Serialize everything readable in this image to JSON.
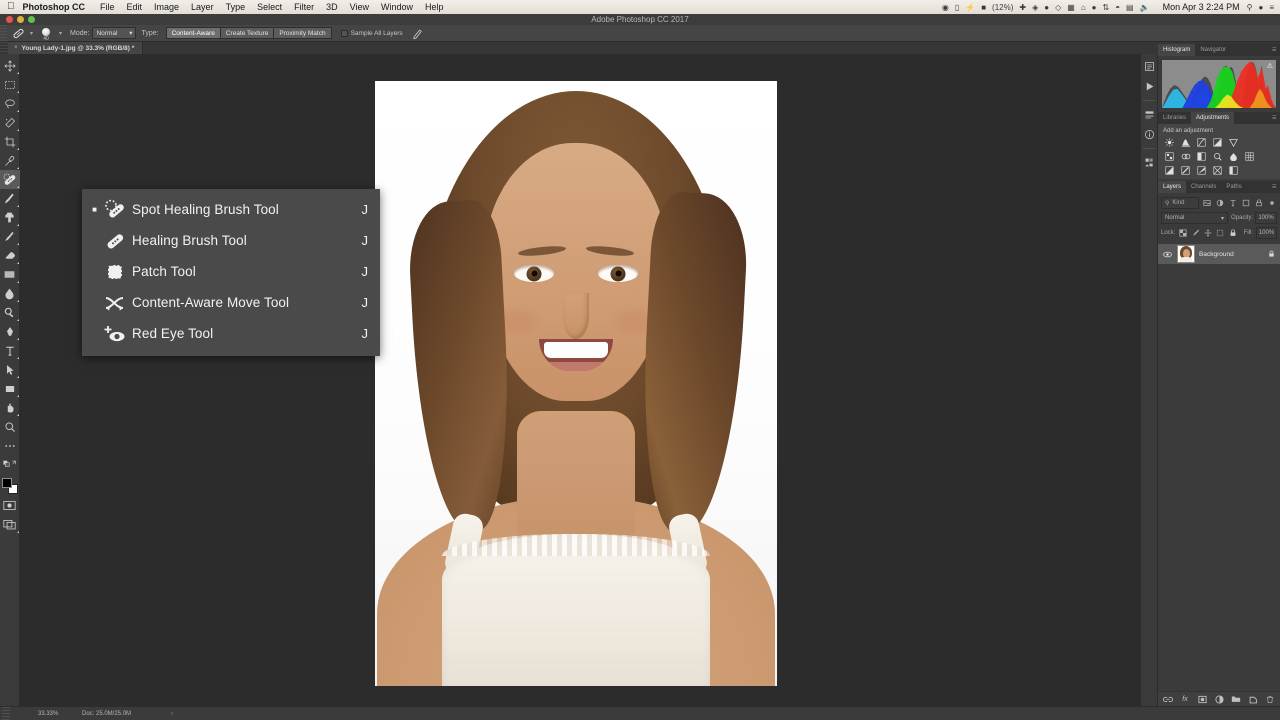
{
  "macmenu": {
    "apple": "apple-logo",
    "app_name": "Photoshop CC",
    "items": [
      "File",
      "Edit",
      "Image",
      "Layer",
      "Type",
      "Select",
      "Filter",
      "3D",
      "View",
      "Window",
      "Help"
    ],
    "battery": "(12%)",
    "clock": "Mon Apr 3  2:24 PM"
  },
  "titlebar": {
    "title": "Adobe Photoshop CC 2017"
  },
  "options": {
    "tool_icon": "spot-healing-brush-icon",
    "brush_size": "40",
    "mode_label": "Mode:",
    "mode_value": "Normal",
    "type_label": "Type:",
    "type_options": [
      "Content-Aware",
      "Create Texture",
      "Proximity Match"
    ],
    "type_selected": "Content-Aware",
    "sample_all_layers": "Sample All Layers",
    "pressure_icon": "pressure-pen-icon"
  },
  "doctab": {
    "close": "×",
    "title": "Young Lady-1.jpg @ 33.3% (RGB/8) *"
  },
  "toolbar": {
    "tools": [
      {
        "name": "move-tool",
        "selected": false
      },
      {
        "name": "rectangular-marquee-tool",
        "selected": false
      },
      {
        "name": "lasso-tool",
        "selected": false
      },
      {
        "name": "quick-selection-tool",
        "selected": false
      },
      {
        "name": "crop-tool",
        "selected": false
      },
      {
        "name": "eyedropper-tool",
        "selected": false
      },
      {
        "name": "spot-healing-brush-tool",
        "selected": true
      },
      {
        "name": "brush-tool",
        "selected": false
      },
      {
        "name": "clone-stamp-tool",
        "selected": false
      },
      {
        "name": "eraser-tool",
        "selected": false
      },
      {
        "name": "gradient-tool",
        "selected": false
      },
      {
        "name": "blur-tool",
        "selected": false
      },
      {
        "name": "dodge-tool",
        "selected": false
      },
      {
        "name": "pen-tool",
        "selected": false
      },
      {
        "name": "type-tool",
        "selected": false
      },
      {
        "name": "path-selection-tool",
        "selected": false
      },
      {
        "name": "shape-tool",
        "selected": false
      },
      {
        "name": "hand-tool",
        "selected": false
      },
      {
        "name": "zoom-tool",
        "selected": false
      }
    ],
    "more_tools": "edit-toolbar-icon",
    "foreground_color": "#000000",
    "background_color": "#ffffff",
    "quick_mask": "quick-mask-icon",
    "screen_mode": "screen-mode-icon"
  },
  "flyout": {
    "items": [
      {
        "label": "Spot Healing Brush Tool",
        "key": "J",
        "icon": "spot-healing-brush-icon",
        "current": true
      },
      {
        "label": "Healing Brush Tool",
        "key": "J",
        "icon": "healing-brush-icon",
        "current": false
      },
      {
        "label": "Patch Tool",
        "key": "J",
        "icon": "patch-icon",
        "current": false
      },
      {
        "label": "Content-Aware Move Tool",
        "key": "J",
        "icon": "content-aware-move-icon",
        "current": false
      },
      {
        "label": "Red Eye Tool",
        "key": "J",
        "icon": "red-eye-icon",
        "current": false
      }
    ]
  },
  "rail": {
    "icons": [
      "history-icon",
      "actions-play-icon",
      "properties-icon",
      "info-icon",
      "color-swatches-icon"
    ]
  },
  "panels": {
    "group_top": {
      "tabs": [
        {
          "label": "Histogram",
          "active": true
        },
        {
          "label": "Navigator",
          "active": false
        }
      ],
      "menu": "panel-menu-icon",
      "histogram_warning": "⚠"
    },
    "group_mid": {
      "tabs": [
        {
          "label": "Libraries",
          "active": false
        },
        {
          "label": "Adjustments",
          "active": true
        }
      ],
      "menu": "panel-menu-icon",
      "title": "Add an adjustment",
      "row1": [
        "brightness-contrast-icon",
        "levels-icon",
        "curves-icon",
        "exposure-icon",
        "vibrance-icon"
      ],
      "row2": [
        "hue-saturation-icon",
        "color-balance-icon",
        "black-white-icon",
        "photo-filter-icon",
        "channel-mixer-icon",
        "color-lookup-icon"
      ],
      "row3": [
        "invert-icon",
        "posterize-icon",
        "threshold-icon",
        "selective-color-icon",
        "gradient-map-icon"
      ]
    },
    "layers": {
      "tabs": [
        {
          "label": "Layers",
          "active": true
        },
        {
          "label": "Channels",
          "active": false
        },
        {
          "label": "Paths",
          "active": false
        }
      ],
      "menu": "panel-menu-icon",
      "filter_placeholder": "Kind",
      "filter_icons": [
        "pixel-filter-icon",
        "adjustment-filter-icon",
        "type-filter-icon",
        "shape-filter-icon",
        "smart-object-filter-icon"
      ],
      "filter_toggle": "filter-toggle-icon",
      "blend_mode": "Normal",
      "opacity_label": "Opacity:",
      "opacity_value": "100%",
      "lock_label": "Lock:",
      "lock_icons": [
        "lock-transparency-icon",
        "lock-image-icon",
        "lock-position-icon",
        "lock-artboard-icon",
        "lock-all-icon"
      ],
      "fill_label": "Fill:",
      "fill_value": "100%",
      "rows": [
        {
          "name": "Background",
          "visible": true,
          "locked": true,
          "thumb": "portrait-thumbnail"
        }
      ],
      "footer_icons": [
        "link-layers-icon",
        "layer-style-fx-icon",
        "add-mask-icon",
        "new-adjustment-icon",
        "new-group-icon",
        "new-layer-icon",
        "delete-layer-icon"
      ]
    }
  },
  "status": {
    "zoom": "33.33%",
    "doc": "Doc: 25.0M/25.0M",
    "arrow": "›"
  },
  "colors": {
    "chrome": "#3b3b3b",
    "panel": "#454545",
    "canvas_bg": "#2c2c2c",
    "accent_text": "#f2f2f2"
  }
}
